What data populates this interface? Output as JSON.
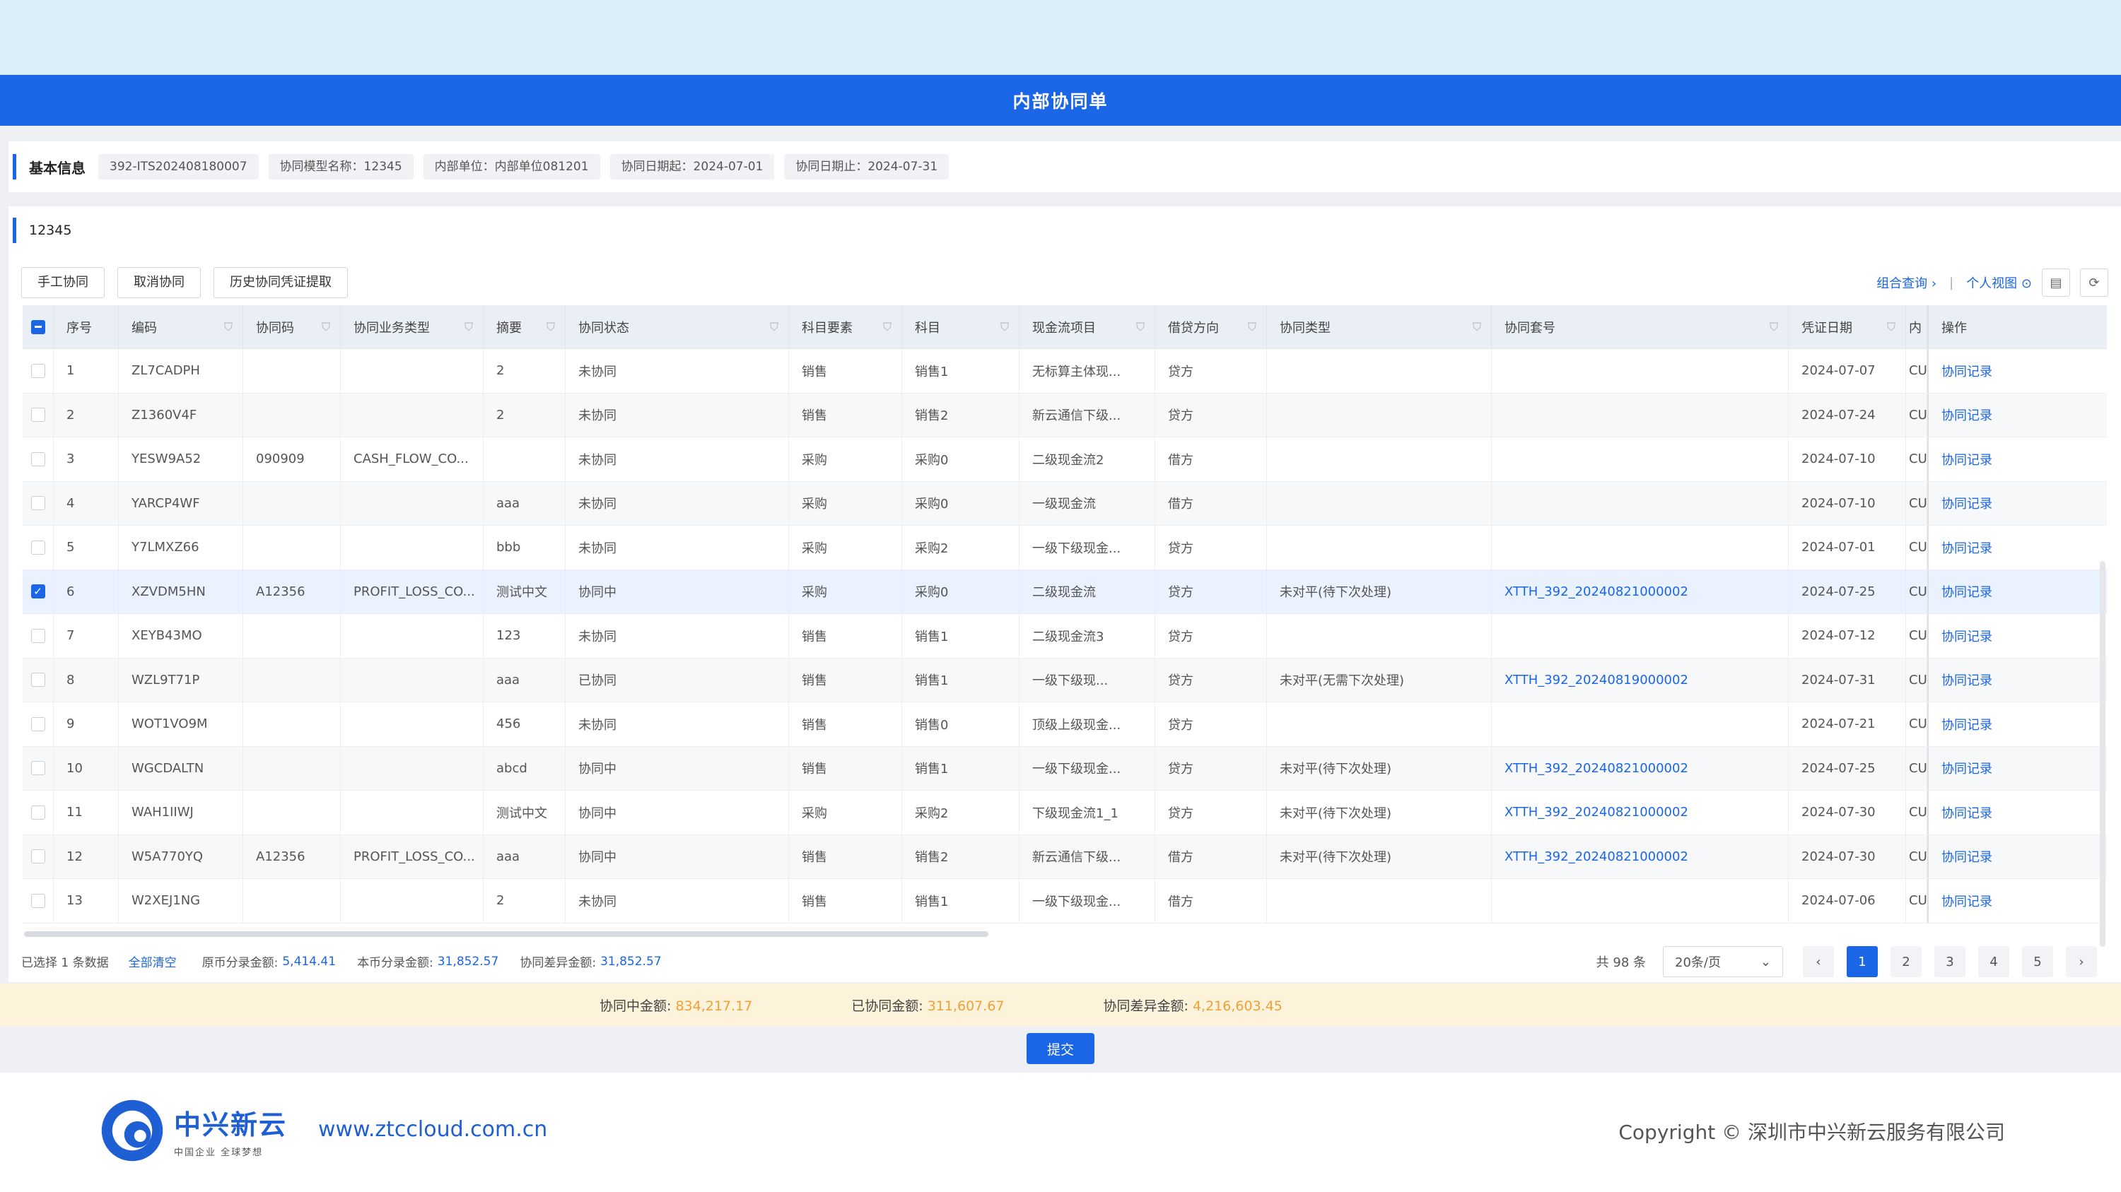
{
  "window": {
    "title": "内部协同单"
  },
  "basic_info": {
    "title": "基本信息",
    "chips": [
      "392-ITS202408180007",
      "协同模型名称：12345",
      "内部单位：内部单位081201",
      "协同日期起：2024-07-01",
      "协同日期止：2024-07-31"
    ]
  },
  "section": {
    "title": "12345"
  },
  "toolbar": {
    "buttons": [
      "手工协同",
      "取消协同",
      "历史协同凭证提取"
    ],
    "combined_query": "组合查询 ›",
    "separator": "|",
    "personal_view": "个人视图 ⊙"
  },
  "table": {
    "columns": [
      "序号",
      "编码",
      "协同码",
      "协同业务类型",
      "摘要",
      "协同状态",
      "科目要素",
      "科目",
      "现金流项目",
      "借贷方向",
      "协同类型",
      "协同套号",
      "凭证日期",
      "内",
      "操作"
    ],
    "rows": [
      {
        "no": "1",
        "code": "ZL7CADPH",
        "sync_code": "",
        "biz_type": "",
        "summary": "2",
        "status": "未协同",
        "element": "销售",
        "subject": "销售1",
        "cash_flow": "无标算主体现...",
        "direction": "贷方",
        "sync_type": "",
        "set_no": "",
        "date": "2024-07-07",
        "inner": "CU",
        "action": "协同记录",
        "checked": false
      },
      {
        "no": "2",
        "code": "Z1360V4F",
        "sync_code": "",
        "biz_type": "",
        "summary": "2",
        "status": "未协同",
        "element": "销售",
        "subject": "销售2",
        "cash_flow": "新云通信下级...",
        "direction": "贷方",
        "sync_type": "",
        "set_no": "",
        "date": "2024-07-24",
        "inner": "CU",
        "action": "协同记录",
        "checked": false
      },
      {
        "no": "3",
        "code": "YESW9A52",
        "sync_code": "090909",
        "biz_type": "CASH_FLOW_CO...",
        "summary": "",
        "status": "未协同",
        "element": "采购",
        "subject": "采购0",
        "cash_flow": "二级现金流2",
        "direction": "借方",
        "sync_type": "",
        "set_no": "",
        "date": "2024-07-10",
        "inner": "CU",
        "action": "协同记录",
        "checked": false
      },
      {
        "no": "4",
        "code": "YARCP4WF",
        "sync_code": "",
        "biz_type": "",
        "summary": "aaa",
        "status": "未协同",
        "element": "采购",
        "subject": "采购0",
        "cash_flow": "一级现金流",
        "direction": "借方",
        "sync_type": "",
        "set_no": "",
        "date": "2024-07-10",
        "inner": "CU",
        "action": "协同记录",
        "checked": false
      },
      {
        "no": "5",
        "code": "Y7LMXZ66",
        "sync_code": "",
        "biz_type": "",
        "summary": "bbb",
        "status": "未协同",
        "element": "采购",
        "subject": "采购2",
        "cash_flow": "一级下级现金...",
        "direction": "贷方",
        "sync_type": "",
        "set_no": "",
        "date": "2024-07-01",
        "inner": "CU",
        "action": "协同记录",
        "checked": false
      },
      {
        "no": "6",
        "code": "XZVDM5HN",
        "sync_code": "A12356",
        "biz_type": "PROFIT_LOSS_CO...",
        "summary": "测试中文",
        "status": "协同中",
        "element": "采购",
        "subject": "采购0",
        "cash_flow": "二级现金流",
        "direction": "贷方",
        "sync_type": "未对平(待下次处理)",
        "set_no": "XTTH_392_20240821000002",
        "date": "2024-07-25",
        "inner": "CU",
        "action": "协同记录",
        "checked": true
      },
      {
        "no": "7",
        "code": "XEYB43MO",
        "sync_code": "",
        "biz_type": "",
        "summary": "123",
        "status": "未协同",
        "element": "销售",
        "subject": "销售1",
        "cash_flow": "二级现金流3",
        "direction": "贷方",
        "sync_type": "",
        "set_no": "",
        "date": "2024-07-12",
        "inner": "CU",
        "action": "协同记录",
        "checked": false
      },
      {
        "no": "8",
        "code": "WZL9T71P",
        "sync_code": "",
        "biz_type": "",
        "summary": "aaa",
        "status": "已协同",
        "element": "销售",
        "subject": "销售1",
        "cash_flow": "一级下级现...",
        "direction": "贷方",
        "sync_type": "未对平(无需下次处理)",
        "set_no": "XTTH_392_20240819000002",
        "date": "2024-07-31",
        "inner": "CU",
        "action": "协同记录",
        "checked": false
      },
      {
        "no": "9",
        "code": "WOT1VO9M",
        "sync_code": "",
        "biz_type": "",
        "summary": "456",
        "status": "未协同",
        "element": "销售",
        "subject": "销售0",
        "cash_flow": "顶级上级现金...",
        "direction": "贷方",
        "sync_type": "",
        "set_no": "",
        "date": "2024-07-21",
        "inner": "CU",
        "action": "协同记录",
        "checked": false
      },
      {
        "no": "10",
        "code": "WGCDALTN",
        "sync_code": "",
        "biz_type": "",
        "summary": "abcd",
        "status": "协同中",
        "element": "销售",
        "subject": "销售1",
        "cash_flow": "一级下级现金...",
        "direction": "贷方",
        "sync_type": "未对平(待下次处理)",
        "set_no": "XTTH_392_20240821000002",
        "date": "2024-07-25",
        "inner": "CU",
        "action": "协同记录",
        "checked": false
      },
      {
        "no": "11",
        "code": "WAH1IIWJ",
        "sync_code": "",
        "biz_type": "",
        "summary": "测试中文",
        "status": "协同中",
        "element": "采购",
        "subject": "采购2",
        "cash_flow": "下级现金流1_1",
        "direction": "贷方",
        "sync_type": "未对平(待下次处理)",
        "set_no": "XTTH_392_20240821000002",
        "date": "2024-07-30",
        "inner": "CU",
        "action": "协同记录",
        "checked": false
      },
      {
        "no": "12",
        "code": "W5A770YQ",
        "sync_code": "A12356",
        "biz_type": "PROFIT_LOSS_CO...",
        "summary": "aaa",
        "status": "协同中",
        "element": "销售",
        "subject": "销售2",
        "cash_flow": "新云通信下级...",
        "direction": "借方",
        "sync_type": "未对平(待下次处理)",
        "set_no": "XTTH_392_20240821000002",
        "date": "2024-07-30",
        "inner": "CU",
        "action": "协同记录",
        "checked": false
      },
      {
        "no": "13",
        "code": "W2XEJ1NG",
        "sync_code": "",
        "biz_type": "",
        "summary": "2",
        "status": "未协同",
        "element": "销售",
        "subject": "销售1",
        "cash_flow": "一级下级现金...",
        "direction": "借方",
        "sync_type": "",
        "set_no": "",
        "date": "2024-07-06",
        "inner": "CU",
        "action": "协同记录",
        "checked": false
      }
    ]
  },
  "summary": {
    "selected": "已选择 1 条数据",
    "clear_all": "全部清空",
    "orig_label": "原币分录金额:",
    "orig_value": "5,414.41",
    "local_label": "本币分录金额:",
    "local_value": "31,852.57",
    "diff_label": "协同差异金额:",
    "diff_value": "31,852.57"
  },
  "pagination": {
    "total": "共 98 条",
    "page_size": "20条/页",
    "pages": [
      "1",
      "2",
      "3",
      "4",
      "5"
    ],
    "current": "1"
  },
  "totals": {
    "in_progress_label": "协同中金额:",
    "in_progress_value": "834,217.17",
    "done_label": "已协同金额:",
    "done_value": "311,607.67",
    "diff_label": "协同差异金额:",
    "diff_value": "4,216,603.45"
  },
  "submit_label": "提交",
  "footer": {
    "brand": "中兴新云",
    "slogan": "中国企业 全球梦想",
    "website": "www.ztccloud.com.cn",
    "copyright": "Copyright © 深圳市中兴新云服务有限公司"
  },
  "colors": {
    "primary": "#1a66e6",
    "accent_amount": "#f0a037",
    "totals_bg": "#fdf3db",
    "top_band": "#daeef7"
  }
}
